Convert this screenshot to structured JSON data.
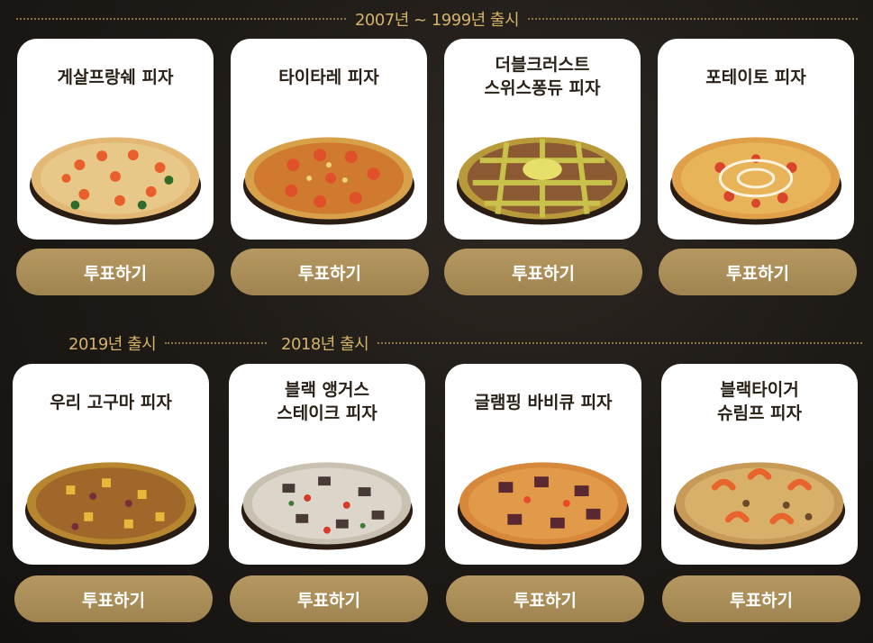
{
  "headers": {
    "era_1999_2007": "2007년 ~ 1999년 출시",
    "era_2019": "2019년 출시",
    "era_2018": "2018년 출시"
  },
  "vote_label": "투표하기",
  "pizzas": [
    {
      "title": "게살프랑쉐 피자"
    },
    {
      "title": "타이타레 피자"
    },
    {
      "title": "더블크러스트\n스위스퐁듀 피자"
    },
    {
      "title": "포테이토 피자"
    },
    {
      "title": "우리 고구마 피자"
    },
    {
      "title": "블랙 앵거스\n스테이크 피자"
    },
    {
      "title": "글램핑 바비큐 피자"
    },
    {
      "title": "블랙타이거\n슈림프 피자"
    }
  ],
  "colors": {
    "accent_gold": "#d4b26a",
    "button_gold": "#a88c56",
    "background": "#1f1b17"
  }
}
